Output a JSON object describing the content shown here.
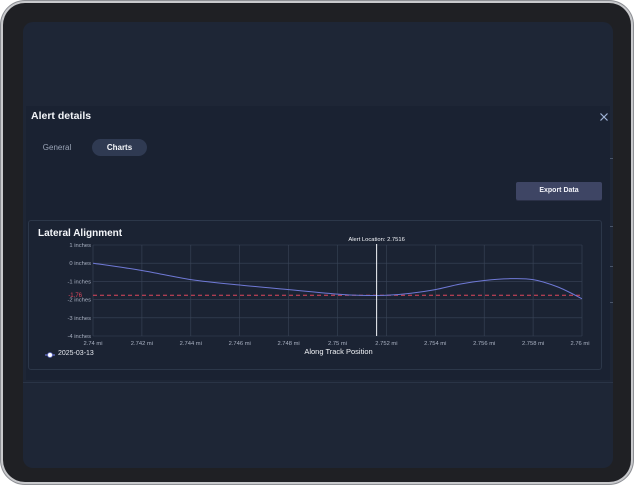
{
  "modal": {
    "title": "Alert details",
    "close_icon": "close-icon",
    "tabs": [
      {
        "label": "General",
        "active": false
      },
      {
        "label": "Charts",
        "active": true
      }
    ]
  },
  "toolbar": {
    "export_label": "Export Data"
  },
  "colors": {
    "background": "#1e2636",
    "series_line": "#6f79d6",
    "threshold": "#e0475c",
    "grid": "#3a4558",
    "button": "#3e4564"
  },
  "chart_data": {
    "type": "line",
    "title": "Lateral Alignment",
    "xlabel": "Along Track Position",
    "ylabel": "",
    "xlim": [
      2.74,
      2.76
    ],
    "ylim": [
      -4,
      1
    ],
    "x_ticks": [
      {
        "value": 2.74,
        "label": "2.74 mi"
      },
      {
        "value": 2.742,
        "label": "2.742 mi"
      },
      {
        "value": 2.744,
        "label": "2.744 mi"
      },
      {
        "value": 2.746,
        "label": "2.746 mi"
      },
      {
        "value": 2.748,
        "label": "2.748 mi"
      },
      {
        "value": 2.75,
        "label": "2.75 mi"
      },
      {
        "value": 2.752,
        "label": "2.752 mi"
      },
      {
        "value": 2.754,
        "label": "2.754 mi"
      },
      {
        "value": 2.756,
        "label": "2.756 mi"
      },
      {
        "value": 2.758,
        "label": "2.758 mi"
      },
      {
        "value": 2.76,
        "label": "2.76 mi"
      }
    ],
    "y_ticks": [
      {
        "value": 1,
        "label": "1 inches"
      },
      {
        "value": 0,
        "label": "0 inches"
      },
      {
        "value": -1,
        "label": "-1 inches"
      },
      {
        "value": -2,
        "label": "-2 inches"
      },
      {
        "value": -3,
        "label": "-3 inches"
      },
      {
        "value": -4,
        "label": "-4 inches"
      }
    ],
    "threshold": {
      "value": -1.76,
      "label": "-1.76"
    },
    "alert_marker": {
      "x": 2.7516,
      "label": "Alert Location: 2.7516"
    },
    "grid": true,
    "legend_position": "bottom-left",
    "series": [
      {
        "name": "2025-03-13",
        "x": [
          2.74,
          2.742,
          2.744,
          2.746,
          2.748,
          2.75,
          2.751,
          2.752,
          2.753,
          2.754,
          2.755,
          2.756,
          2.757,
          2.758,
          2.759,
          2.76
        ],
        "values": [
          0.0,
          -0.4,
          -0.9,
          -1.2,
          -1.45,
          -1.7,
          -1.77,
          -1.76,
          -1.65,
          -1.45,
          -1.15,
          -0.95,
          -0.85,
          -0.9,
          -1.3,
          -1.95
        ]
      }
    ]
  }
}
